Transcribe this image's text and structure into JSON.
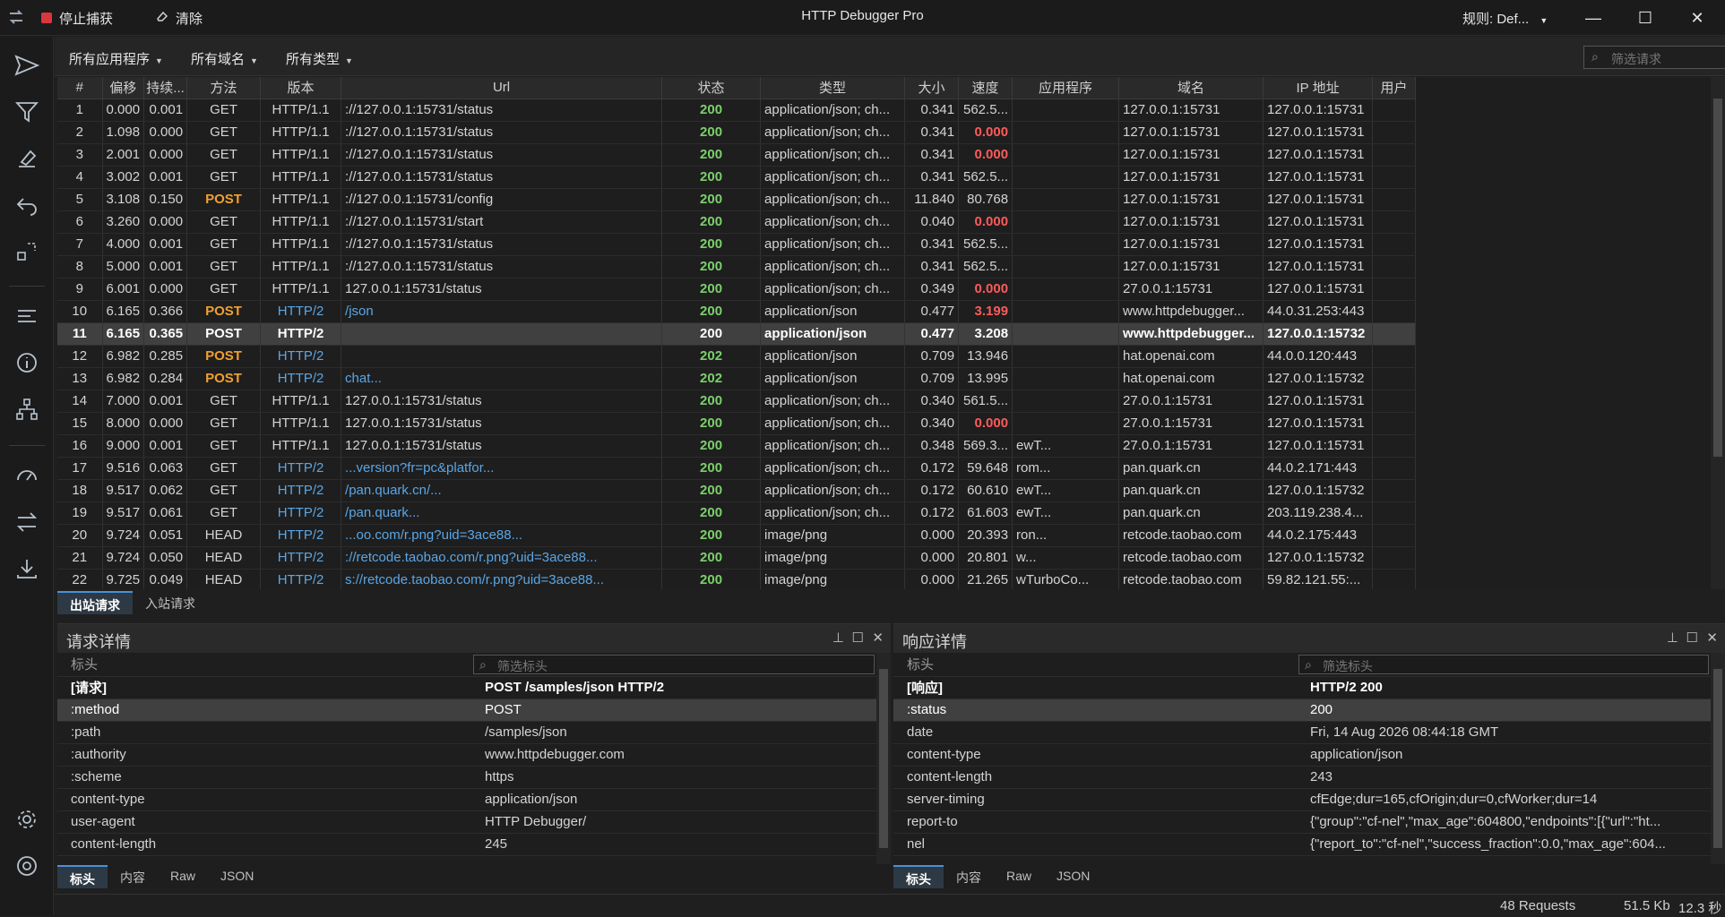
{
  "titlebar": {
    "stop_capture": "停止捕获",
    "clear": "清除",
    "title": "HTTP Debugger Pro",
    "rule": "规则: Def...",
    "minimize": "—",
    "maximize": "☐",
    "close": "✕"
  },
  "filters": {
    "apps": "所有应用程序",
    "domains": "所有域名",
    "types": "所有类型",
    "search_placeholder": "筛选请求"
  },
  "columns": [
    "#",
    "偏移",
    "持续...",
    "方法",
    "版本",
    "Url",
    "状态",
    "类型",
    "大小",
    "速度",
    "应用程序",
    "域名",
    "IP 地址",
    "用户"
  ],
  "rows": [
    {
      "n": "1",
      "off": "0.000",
      "dur": "0.001",
      "method": "GET",
      "ver": "HTTP/1.1",
      "url": "://127.0.0.1:15731/status",
      "status": "200",
      "type": "application/json; ch...",
      "size": "0.341",
      "speed": "562.5...",
      "app": "",
      "domain": "127.0.0.1:15731",
      "ip": "127.0.0.1:15731"
    },
    {
      "n": "2",
      "off": "1.098",
      "dur": "0.000",
      "method": "GET",
      "ver": "HTTP/1.1",
      "url": "://127.0.0.1:15731/status",
      "status": "200",
      "type": "application/json; ch...",
      "size": "0.341",
      "speed": "0.000",
      "app": "",
      "domain": "127.0.0.1:15731",
      "ip": "127.0.0.1:15731"
    },
    {
      "n": "3",
      "off": "2.001",
      "dur": "0.000",
      "method": "GET",
      "ver": "HTTP/1.1",
      "url": "://127.0.0.1:15731/status",
      "status": "200",
      "type": "application/json; ch...",
      "size": "0.341",
      "speed": "0.000",
      "app": "",
      "domain": "127.0.0.1:15731",
      "ip": "127.0.0.1:15731"
    },
    {
      "n": "4",
      "off": "3.002",
      "dur": "0.001",
      "method": "GET",
      "ver": "HTTP/1.1",
      "url": "://127.0.0.1:15731/status",
      "status": "200",
      "type": "application/json; ch...",
      "size": "0.341",
      "speed": "562.5...",
      "app": "",
      "domain": "127.0.0.1:15731",
      "ip": "127.0.0.1:15731"
    },
    {
      "n": "5",
      "off": "3.108",
      "dur": "0.150",
      "method": "POST",
      "ver": "HTTP/1.1",
      "url": "://127.0.0.1:15731/config",
      "status": "200",
      "type": "application/json; ch...",
      "size": "11.840",
      "speed": "80.768",
      "app": "",
      "domain": "127.0.0.1:15731",
      "ip": "127.0.0.1:15731"
    },
    {
      "n": "6",
      "off": "3.260",
      "dur": "0.000",
      "method": "GET",
      "ver": "HTTP/1.1",
      "url": "://127.0.0.1:15731/start",
      "status": "200",
      "type": "application/json; ch...",
      "size": "0.040",
      "speed": "0.000",
      "app": "",
      "domain": "127.0.0.1:15731",
      "ip": "127.0.0.1:15731"
    },
    {
      "n": "7",
      "off": "4.000",
      "dur": "0.001",
      "method": "GET",
      "ver": "HTTP/1.1",
      "url": "://127.0.0.1:15731/status",
      "status": "200",
      "type": "application/json; ch...",
      "size": "0.341",
      "speed": "562.5...",
      "app": "",
      "domain": "127.0.0.1:15731",
      "ip": "127.0.0.1:15731"
    },
    {
      "n": "8",
      "off": "5.000",
      "dur": "0.001",
      "method": "GET",
      "ver": "HTTP/1.1",
      "url": "://127.0.0.1:15731/status",
      "status": "200",
      "type": "application/json; ch...",
      "size": "0.341",
      "speed": "562.5...",
      "app": "",
      "domain": "127.0.0.1:15731",
      "ip": "127.0.0.1:15731"
    },
    {
      "n": "9",
      "off": "6.001",
      "dur": "0.000",
      "method": "GET",
      "ver": "HTTP/1.1",
      "url": "127.0.0.1:15731/status",
      "status": "200",
      "type": "application/json; ch...",
      "size": "0.349",
      "speed": "0.000",
      "app": "",
      "domain": "27.0.0.1:15731",
      "ip": "127.0.0.1:15731"
    },
    {
      "n": "10",
      "off": "6.165",
      "dur": "0.366",
      "method": "POST",
      "ver": "HTTP/2",
      "url": "/json",
      "status": "200",
      "type": "application/json",
      "size": "0.477",
      "speed": "3.199",
      "app": "",
      "domain": "www.httpdebugger...",
      "ip": "44.0.31.253:443"
    },
    {
      "n": "11",
      "off": "6.165",
      "dur": "0.365",
      "method": "POST",
      "ver": "HTTP/2",
      "url": "",
      "status": "200",
      "type": "application/json",
      "size": "0.477",
      "speed": "3.208",
      "app": "",
      "domain": "www.httpdebugger...",
      "ip": "127.0.0.1:15732"
    },
    {
      "n": "12",
      "off": "6.982",
      "dur": "0.285",
      "method": "POST",
      "ver": "HTTP/2",
      "url": "",
      "status": "202",
      "type": "application/json",
      "size": "0.709",
      "speed": "13.946",
      "app": "",
      "domain": "hat.openai.com",
      "ip": "44.0.0.120:443"
    },
    {
      "n": "13",
      "off": "6.982",
      "dur": "0.284",
      "method": "POST",
      "ver": "HTTP/2",
      "url": "chat...",
      "status": "202",
      "type": "application/json",
      "size": "0.709",
      "speed": "13.995",
      "app": "",
      "domain": "hat.openai.com",
      "ip": "127.0.0.1:15732"
    },
    {
      "n": "14",
      "off": "7.000",
      "dur": "0.001",
      "method": "GET",
      "ver": "HTTP/1.1",
      "url": "127.0.0.1:15731/status",
      "status": "200",
      "type": "application/json; ch...",
      "size": "0.340",
      "speed": "561.5...",
      "app": "",
      "domain": "27.0.0.1:15731",
      "ip": "127.0.0.1:15731"
    },
    {
      "n": "15",
      "off": "8.000",
      "dur": "0.000",
      "method": "GET",
      "ver": "HTTP/1.1",
      "url": "127.0.0.1:15731/status",
      "status": "200",
      "type": "application/json; ch...",
      "size": "0.340",
      "speed": "0.000",
      "app": "",
      "domain": "27.0.0.1:15731",
      "ip": "127.0.0.1:15731"
    },
    {
      "n": "16",
      "off": "9.000",
      "dur": "0.001",
      "method": "GET",
      "ver": "HTTP/1.1",
      "url": "127.0.0.1:15731/status",
      "status": "200",
      "type": "application/json; ch...",
      "size": "0.348",
      "speed": "569.3...",
      "app": "ewT...",
      "domain": "27.0.0.1:15731",
      "ip": "127.0.0.1:15731"
    },
    {
      "n": "17",
      "off": "9.516",
      "dur": "0.063",
      "method": "GET",
      "ver": "HTTP/2",
      "url": "...version?fr=pc&platfor...",
      "status": "200",
      "type": "application/json; ch...",
      "size": "0.172",
      "speed": "59.648",
      "app": "rom...",
      "domain": "pan.quark.cn",
      "ip": "44.0.2.171:443"
    },
    {
      "n": "18",
      "off": "9.517",
      "dur": "0.062",
      "method": "GET",
      "ver": "HTTP/2",
      "url": "/pan.quark.cn/...",
      "status": "200",
      "type": "application/json; ch...",
      "size": "0.172",
      "speed": "60.610",
      "app": "ewT...",
      "domain": "pan.quark.cn",
      "ip": "127.0.0.1:15732"
    },
    {
      "n": "19",
      "off": "9.517",
      "dur": "0.061",
      "method": "GET",
      "ver": "HTTP/2",
      "url": "/pan.quark...",
      "status": "200",
      "type": "application/json; ch...",
      "size": "0.172",
      "speed": "61.603",
      "app": "ewT...",
      "domain": "pan.quark.cn",
      "ip": "203.119.238.4..."
    },
    {
      "n": "20",
      "off": "9.724",
      "dur": "0.051",
      "method": "HEAD",
      "ver": "HTTP/2",
      "url": "...oo.com/r.png?uid=3ace88...",
      "status": "200",
      "type": "image/png",
      "size": "0.000",
      "speed": "20.393",
      "app": "ron...",
      "domain": "retcode.taobao.com",
      "ip": "44.0.2.175:443"
    },
    {
      "n": "21",
      "off": "9.724",
      "dur": "0.050",
      "method": "HEAD",
      "ver": "HTTP/2",
      "url": "://retcode.taobao.com/r.png?uid=3ace88...",
      "status": "200",
      "type": "image/png",
      "size": "0.000",
      "speed": "20.801",
      "app": "w...",
      "domain": "retcode.taobao.com",
      "ip": "127.0.0.1:15732"
    },
    {
      "n": "22",
      "off": "9.725",
      "dur": "0.049",
      "method": "HEAD",
      "ver": "HTTP/2",
      "url": "s://retcode.taobao.com/r.png?uid=3ace88...",
      "status": "200",
      "type": "image/png",
      "size": "0.000",
      "speed": "21.265",
      "app": "wTurboCo...",
      "domain": "retcode.taobao.com",
      "ip": "59.82.121.55:..."
    }
  ],
  "traffic_tabs": [
    "出站请求",
    "入站请求"
  ],
  "request_panel": {
    "title": "请求详情",
    "col_header": "标头",
    "filter_placeholder": "筛选标头",
    "first": {
      "k": "[请求]",
      "v": "POST /samples/json HTTP/2"
    },
    "rows": [
      {
        "k": ":method",
        "v": "POST"
      },
      {
        "k": ":path",
        "v": "/samples/json"
      },
      {
        "k": ":authority",
        "v": "www.httpdebugger.com"
      },
      {
        "k": ":scheme",
        "v": "https"
      },
      {
        "k": "content-type",
        "v": "application/json"
      },
      {
        "k": "user-agent",
        "v": "HTTP Debugger/"
      },
      {
        "k": "content-length",
        "v": "245"
      }
    ],
    "tabs": [
      "标头",
      "内容",
      "Raw",
      "JSON"
    ]
  },
  "response_panel": {
    "title": "响应详情",
    "col_header": "标头",
    "filter_placeholder": "筛选标头",
    "first": {
      "k": "[响应]",
      "v": "HTTP/2 200"
    },
    "rows": [
      {
        "k": ":status",
        "v": "200"
      },
      {
        "k": "date",
        "v": "Fri, 14 Aug 2026 08:44:18 GMT"
      },
      {
        "k": "content-type",
        "v": "application/json"
      },
      {
        "k": "content-length",
        "v": "243"
      },
      {
        "k": "server-timing",
        "v": "cfEdge;dur=165,cfOrigin;dur=0,cfWorker;dur=14"
      },
      {
        "k": "report-to",
        "v": "{\"group\":\"cf-nel\",\"max_age\":604800,\"endpoints\":[{\"url\":\"ht..."
      },
      {
        "k": "nel",
        "v": "{\"report_to\":\"cf-nel\",\"success_fraction\":0.0,\"max_age\":604..."
      }
    ],
    "tabs": [
      "标头",
      "内容",
      "Raw",
      "JSON"
    ]
  },
  "statusbar": {
    "requests": "48 Requests",
    "size": "51.5 Kb",
    "time": "12.3 秒"
  }
}
